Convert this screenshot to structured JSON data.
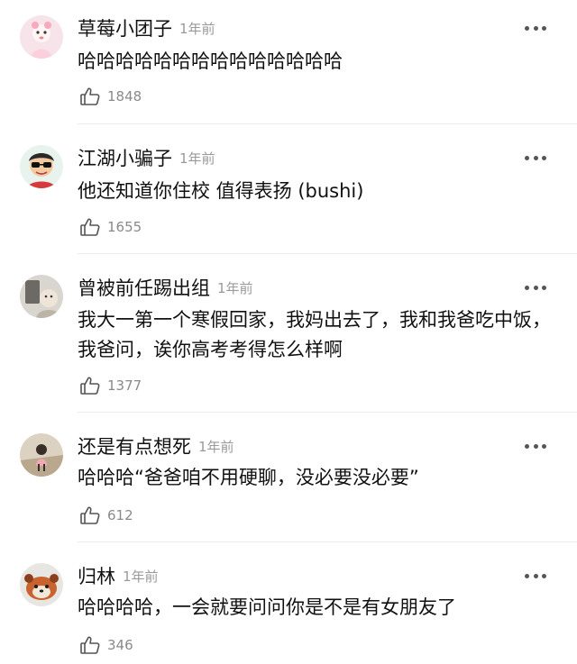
{
  "comments": [
    {
      "author": "草莓小团子",
      "time": "1年前",
      "text": "哈哈哈哈哈哈哈哈哈哈哈哈哈哈",
      "likes": "1848"
    },
    {
      "author": "江湖小骗子",
      "time": "1年前",
      "text": "他还知道你住校 值得表扬 (bushi)",
      "likes": "1655"
    },
    {
      "author": "曾被前任踢出组",
      "time": "1年前",
      "text": "我大一第一个寒假回家，我妈出去了，我和我爸吃中饭，我爸问，诶你高考考得怎么样啊",
      "likes": "1377"
    },
    {
      "author": "还是有点想死",
      "time": "1年前",
      "text": "哈哈哈“爸爸咱不用硬聊，没必要没必要”",
      "likes": "612"
    },
    {
      "author": "归林",
      "time": "1年前",
      "text": "哈哈哈哈，一会就要问问你是不是有女朋友了",
      "likes": "346"
    }
  ],
  "icons": {
    "like": "thumbs-up-icon",
    "more": "more-dots-icon"
  },
  "colors": {
    "text": "#111111",
    "meta": "#9a9a9a",
    "divider": "#ececec"
  }
}
